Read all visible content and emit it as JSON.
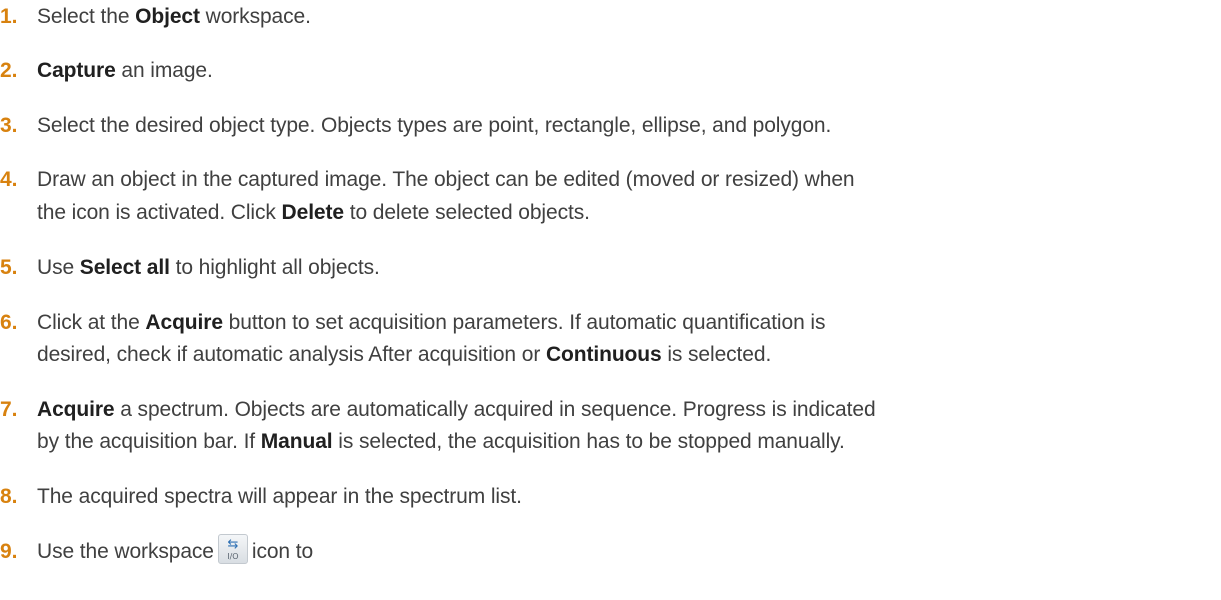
{
  "steps": [
    {
      "number": "1.",
      "parts": [
        "Select the ",
        "Object",
        " workspace."
      ]
    },
    {
      "number": "2.",
      "parts": [
        "Capture",
        " an image."
      ]
    },
    {
      "number": "3.",
      "parts": [
        "Select the desired object type. Objects types are point, rectangle, ellipse, and polygon."
      ]
    },
    {
      "number": "4.",
      "line1": [
        "Draw an object in the captured image. The object can be edited (moved or resized) when"
      ],
      "line2": [
        "the icon is activated. Click ",
        "Delete",
        " to delete selected objects."
      ]
    },
    {
      "number": "5.",
      "parts": [
        "Use ",
        "Select all",
        " to highlight all objects."
      ]
    },
    {
      "number": "6.",
      "line1": [
        "Click at the ",
        "Acquire",
        " button to set acquisition parameters. If automatic quantification is"
      ],
      "line2": [
        "desired, check if automatic analysis After acquisition or ",
        "Continuous",
        " is selected."
      ]
    },
    {
      "number": "7.",
      "line1": [
        "Acquire",
        " a spectrum. Objects are automatically acquired in sequence. Progress is indicated"
      ],
      "line2": [
        "by the acquisition bar. If ",
        "Manual",
        " is selected, the acquisition has to be stopped manually."
      ]
    },
    {
      "number": "8.",
      "parts": [
        "The acquired spectra will appear in the spectrum list."
      ]
    },
    {
      "number": "9.",
      "before_icon": "Use the workspace",
      "after_icon": "icon to",
      "icon": {
        "name": "io-swap-icon",
        "glyph": "⇆",
        "label": "I/O"
      }
    }
  ],
  "colors": {
    "step_number": "#d8820f",
    "body_text": "#404040",
    "bold_text": "#202020",
    "icon_arrows": "#2d6fb3"
  }
}
